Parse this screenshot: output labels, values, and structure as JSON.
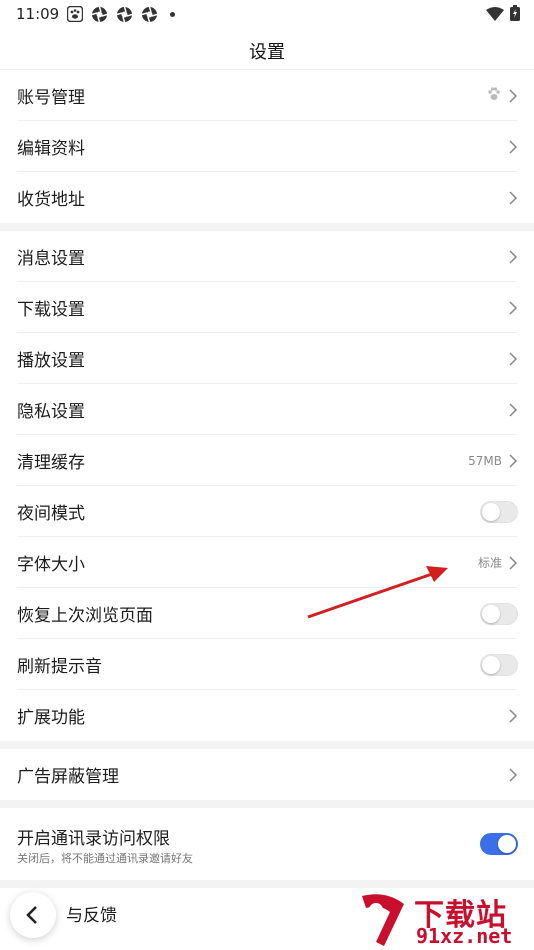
{
  "status_bar": {
    "time": "11:09",
    "left_icons": [
      "paw-app-icon",
      "aperture-app-icon",
      "aperture-app-icon",
      "aperture-app-icon",
      "dot"
    ],
    "right_icons": [
      "wifi-icon",
      "battery-charging-icon"
    ]
  },
  "header": {
    "title": "设置"
  },
  "group1": [
    {
      "label": "账号管理",
      "value": "",
      "icon": "paw-icon"
    },
    {
      "label": "编辑资料",
      "value": ""
    },
    {
      "label": "收货地址",
      "value": ""
    }
  ],
  "group2": [
    {
      "label": "消息设置",
      "value": ""
    },
    {
      "label": "下载设置",
      "value": ""
    },
    {
      "label": "播放设置",
      "value": ""
    },
    {
      "label": "隐私设置",
      "value": ""
    },
    {
      "label": "清理缓存",
      "value": "57MB"
    },
    {
      "label": "夜间模式",
      "toggle": false
    },
    {
      "label": "字体大小",
      "value": "标准"
    },
    {
      "label": "恢复上次浏览页面",
      "toggle": false
    },
    {
      "label": "刷新提示音",
      "toggle": false
    },
    {
      "label": "扩展功能",
      "value": ""
    }
  ],
  "group3": [
    {
      "label": "广告屏蔽管理",
      "value": ""
    }
  ],
  "group4": {
    "label": "开启通讯录访问权限",
    "sublabel": "关闭后，将不能通过通讯录邀请好友",
    "toggle": true
  },
  "group5": [
    {
      "label": "帮助与反馈",
      "visible_label": "与反馈"
    }
  ],
  "annotation": {
    "color": "#d0201f",
    "points_to": "字体大小"
  },
  "watermark": {
    "brand": "下载站",
    "url": "91xz.net",
    "color": "#c8102e"
  },
  "colors": {
    "accent": "#3b6fe8",
    "toggle_off": "#e9e9e9",
    "separator": "#f3f3f3"
  }
}
